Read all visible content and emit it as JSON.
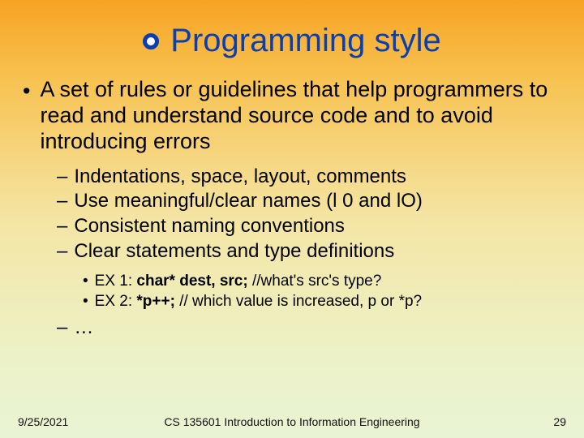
{
  "title": "Programming style",
  "main_bullet": "A set of rules or guidelines that help programmers to read and understand source code and to avoid introducing errors",
  "sub_items": [
    "Indentations, space, layout, comments",
    "Use meaningful/clear names (l 0 and lO)",
    "Consistent naming conventions",
    "Clear statements and type definitions"
  ],
  "examples": {
    "ex1_label": "EX 1: ",
    "ex1_code": "char* dest, src;",
    "ex1_comment": "  //what's src's type?",
    "ex2_label": "EX 2: ",
    "ex2_code": "*p++;",
    "ex2_comment": "  // which value is increased, p or *p?"
  },
  "trailing_sub": "…",
  "footer": {
    "date": "9/25/2021",
    "course": "CS 135601 Introduction to Information Engineering",
    "page": "29"
  }
}
